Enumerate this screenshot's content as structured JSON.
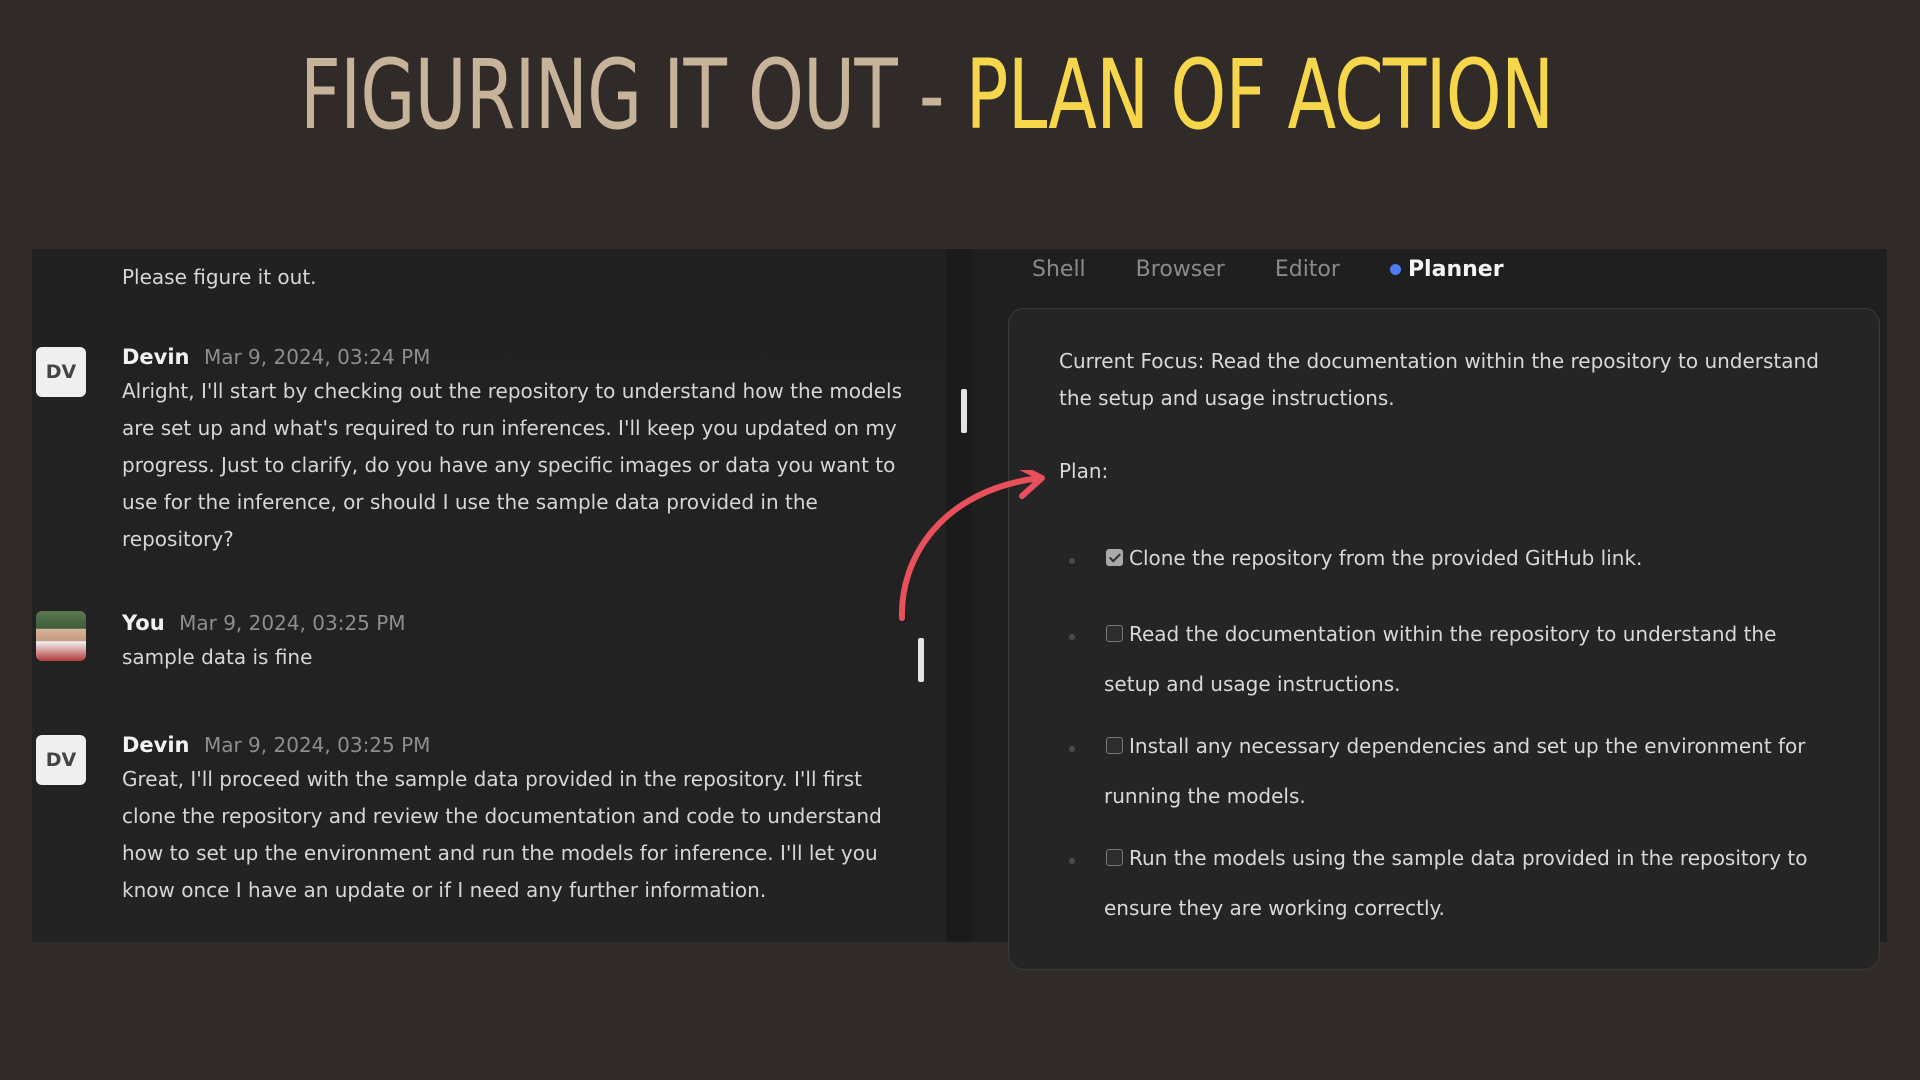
{
  "slide": {
    "title_part_a": "FIGURING IT OUT - ",
    "title_part_b": "PLAN OF ACTION",
    "colors": {
      "title_a": "#c6b39a",
      "title_b": "#f6d64a",
      "background": "#302a29",
      "arrow": "#e8505b"
    }
  },
  "chat": {
    "top_text": "Please figure it out.",
    "messages": [
      {
        "avatar": "DV",
        "author": "Devin",
        "timestamp": "Mar 9, 2024, 03:24 PM",
        "lines": [
          "Alright, I'll start by checking out the repository to understand how the models",
          "are set up and what's required to run inferences. I'll keep you updated on my",
          "progress. Just to clarify, do you have any specific images or data you want to",
          "use for the inference, or should I use the sample data provided in the",
          "repository?"
        ]
      },
      {
        "avatar": "",
        "author": "You",
        "timestamp": "Mar 9, 2024, 03:25 PM",
        "lines": [
          "sample data is fine"
        ]
      },
      {
        "avatar": "DV",
        "author": "Devin",
        "timestamp": "Mar 9, 2024, 03:25 PM",
        "lines": [
          "Great, I'll proceed with the sample data provided in the repository. I'll first",
          "clone the repository and review the documentation and code to understand",
          "how to set up the environment and run the models for inference. I'll let you",
          "know once I have an update or if I need any further information."
        ]
      }
    ]
  },
  "tabs": {
    "items": [
      "Shell",
      "Browser",
      "Editor",
      "Planner"
    ],
    "active": "Planner",
    "active_dot_color": "#4f7cf2"
  },
  "planner": {
    "focus_lines": [
      "Current Focus: Read the documentation within the repository to understand",
      "the setup and usage instructions."
    ],
    "plan_label": "Plan:",
    "items": [
      {
        "checked": true,
        "lines": [
          "Clone the repository from the provided GitHub link."
        ]
      },
      {
        "checked": false,
        "lines": [
          "Read the documentation within the repository to understand the",
          "setup and usage instructions."
        ]
      },
      {
        "checked": false,
        "lines": [
          "Install any necessary dependencies and set up the environment for",
          "running the models."
        ]
      },
      {
        "checked": false,
        "lines": [
          "Run the models using the sample data provided in the repository to",
          "ensure they are working correctly."
        ]
      }
    ]
  }
}
